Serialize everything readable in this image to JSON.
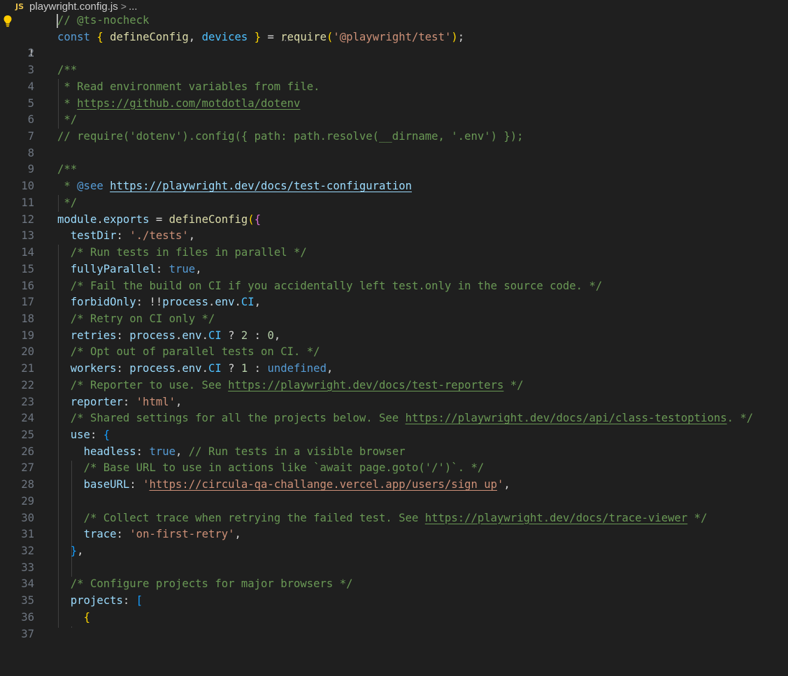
{
  "breadcrumb": {
    "file_icon": "JS",
    "file_name": "playwright.config.js",
    "separator": ">",
    "more": "..."
  },
  "editor": {
    "line_numbers": [
      "1",
      "2",
      "3",
      "4",
      "5",
      "6",
      "7",
      "8",
      "9",
      "10",
      "11",
      "12",
      "13",
      "14",
      "15",
      "16",
      "17",
      "18",
      "19",
      "20",
      "21",
      "22",
      "23",
      "24",
      "25",
      "26",
      "27",
      "28",
      "29",
      "30",
      "31",
      "32",
      "33",
      "34",
      "35",
      "36",
      "37"
    ],
    "tokens": {
      "l1": "// @ts-nocheck",
      "l2_const": "const",
      "l2_open": "{",
      "l2_define": "defineConfig",
      "l2_comma": ",",
      "l2_devices": "devices",
      "l2_close": "}",
      "l2_eq": "=",
      "l2_require": "require",
      "l2_paren_open": "(",
      "l2_str": "'@playwright/test'",
      "l2_paren_close": ")",
      "l2_semi": ";",
      "l4": "/**",
      "l5": " * Read environment variables from file.",
      "l6_prefix": " * ",
      "l6_url": "https://github.com/motdotla/dotenv",
      "l7": " */",
      "l8": "// require('dotenv').config({ path: path.resolve(__dirname, '.env') });",
      "l10": "/**",
      "l11_prefix": " * ",
      "l11_tag": "@see",
      "l11_space": " ",
      "l11_url": "https://playwright.dev/docs/test-configuration",
      "l12": " */",
      "l13_module": "module",
      "l13_dot": ".",
      "l13_exports": "exports",
      "l13_eq": " = ",
      "l13_define": "defineConfig",
      "l13_paren": "(",
      "l13_brace": "{",
      "l14_key": "testDir",
      "l14_colon": ": ",
      "l14_val": "'./tests'",
      "l14_comma": ",",
      "l15": "/* Run tests in files in parallel */",
      "l16_key": "fullyParallel",
      "l16_colon": ": ",
      "l16_val": "true",
      "l16_comma": ",",
      "l17": "/* Fail the build on CI if you accidentally left test.only in the source code. */",
      "l18_key": "forbidOnly",
      "l18_colon": ": !!",
      "l18_process": "process",
      "l18_dot1": ".",
      "l18_env": "env",
      "l18_dot2": ".",
      "l18_ci": "CI",
      "l18_comma": ",",
      "l19": "/* Retry on CI only */",
      "l20_key": "retries",
      "l20_colon": ": ",
      "l20_process": "process",
      "l20_dot1": ".",
      "l20_env": "env",
      "l20_dot2": ".",
      "l20_ci": "CI",
      "l20_q": " ? ",
      "l20_n1": "2",
      "l20_c": " : ",
      "l20_n2": "0",
      "l20_comma": ",",
      "l21": "/* Opt out of parallel tests on CI. */",
      "l22_key": "workers",
      "l22_colon": ": ",
      "l22_process": "process",
      "l22_dot1": ".",
      "l22_env": "env",
      "l22_dot2": ".",
      "l22_ci": "CI",
      "l22_q": " ? ",
      "l22_n1": "1",
      "l22_c": " : ",
      "l22_undef": "undefined",
      "l22_comma": ",",
      "l23_prefix": "/* Reporter to use. See ",
      "l23_url": "https://playwright.dev/docs/test-reporters",
      "l23_suffix": " */",
      "l24_key": "reporter",
      "l24_colon": ": ",
      "l24_val": "'html'",
      "l24_comma": ",",
      "l25_prefix": "/* Shared settings for all the projects below. See ",
      "l25_url": "https://playwright.dev/docs/api/class-testoptions",
      "l25_suffix": ". */",
      "l26_key": "use",
      "l26_colon": ": ",
      "l26_brace": "{",
      "l27_key": "headless",
      "l27_colon": ": ",
      "l27_val": "true",
      "l27_comma": ", ",
      "l27_comment": "// Run tests in a visible browser",
      "l28": "/* Base URL to use in actions like `await page.goto('/')`. */",
      "l29_key": "baseURL",
      "l29_colon": ": ",
      "l29_q1": "'",
      "l29_url": "https://circula-qa-challange.vercel.app/users/sign_up",
      "l29_q2": "'",
      "l29_comma": ",",
      "l31_prefix": "/* Collect trace when retrying the failed test. See ",
      "l31_url": "https://playwright.dev/docs/trace-viewer",
      "l31_suffix": " */",
      "l32_key": "trace",
      "l32_colon": ": ",
      "l32_val": "'on-first-retry'",
      "l32_comma": ",",
      "l33_brace": "}",
      "l33_comma": ",",
      "l35": "/* Configure projects for major browsers */",
      "l36_key": "projects",
      "l36_colon": ": ",
      "l36_bracket": "[",
      "l37_brace": "{"
    }
  },
  "colors": {
    "background": "#1f1f1f",
    "comment": "#6a9955",
    "keyword": "#569cd6",
    "variable": "#9cdcfe",
    "function": "#dcdcaa",
    "string": "#ce9178",
    "number": "#b5cea8",
    "bracket_gold": "#ffd700",
    "bracket_orchid": "#da70d6",
    "bracket_blue": "#179fff"
  },
  "icons": {
    "lightbulb": "lightbulb-icon",
    "js_file": "js-file-icon"
  }
}
